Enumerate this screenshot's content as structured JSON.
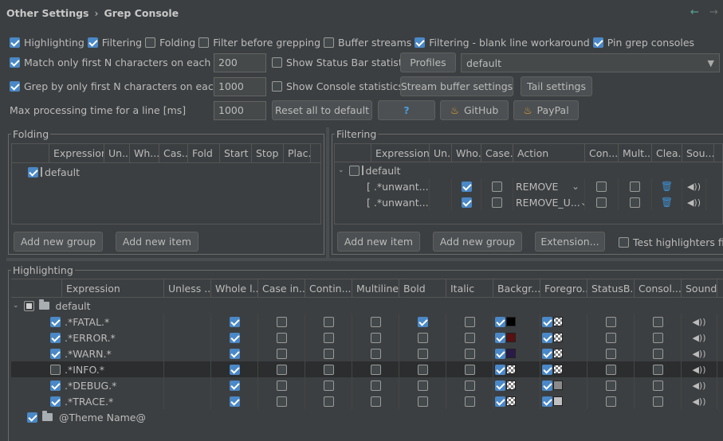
{
  "breadcrumb": {
    "parent": "Other Settings",
    "sep": "›",
    "current": "Grep Console"
  },
  "nav": {
    "back_icon": "←",
    "forward_icon": "→"
  },
  "options_row1": [
    {
      "label": "Highlighting",
      "checked": true
    },
    {
      "label": "Filtering",
      "checked": true
    },
    {
      "label": "Folding",
      "checked": false
    },
    {
      "label": "Filter before grepping",
      "checked": false
    },
    {
      "label": "Buffer streams",
      "checked": false
    },
    {
      "label": "Filtering - blank line workaround",
      "checked": true
    },
    {
      "label": "Pin grep consoles",
      "checked": true
    }
  ],
  "match_first_n": {
    "label": "Match only first N characters on each line",
    "checked": true,
    "value": "200"
  },
  "grep_first_n": {
    "label": "Grep by only first N characters on each line",
    "checked": true,
    "value": "1000"
  },
  "max_time": {
    "label": "Max processing time for a line [ms]",
    "value": "1000"
  },
  "show_statusbar": {
    "label": "Show Status Bar statistics",
    "checked": false
  },
  "show_console": {
    "label": "Show Console statistics",
    "checked": false
  },
  "buttons": {
    "profiles": "Profiles",
    "stream_buffer": "Stream buffer settings",
    "tail": "Tail settings",
    "reset": "Reset all to default",
    "help": "?",
    "github": "GitHub",
    "paypal": "PayPal"
  },
  "profile_select": {
    "value": "default"
  },
  "folding": {
    "title": "Folding",
    "columns": [
      "Expression",
      "Un...",
      "Wh...",
      "Cas...",
      "Fold",
      "Start",
      "Stop",
      "Plac..."
    ],
    "rows": [
      {
        "expression": "default",
        "checked": true
      }
    ],
    "add_group": "Add new group",
    "add_item": "Add new item"
  },
  "filtering": {
    "title": "Filtering",
    "columns": [
      "Expression",
      "Un...",
      "Who...",
      "Case...",
      "Action",
      "Con...",
      "Mult...",
      "Clea...",
      "Sou..."
    ],
    "group": "default",
    "rows": [
      {
        "expression": "[ .*unwant...",
        "whole": true,
        "case": false,
        "action": "REMOVE",
        "con": false,
        "mult": false
      },
      {
        "expression": "[ .*unwant...",
        "whole": true,
        "case": false,
        "action": "REMOVE_U...",
        "con": false,
        "mult": false
      }
    ],
    "add_item": "Add new item",
    "add_group": "Add new group",
    "extension": "Extension...",
    "test_label": "Test highlighters first"
  },
  "highlighting": {
    "title": "Highlighting",
    "columns": [
      "Expression",
      "Unless ...",
      "Whole l...",
      "Case in...",
      "Contin...",
      "Multiline",
      "Bold",
      "Italic",
      "Backgr...",
      "Foregro...",
      "StatusB...",
      "Consol...",
      "Sound"
    ],
    "group": "default",
    "rows": [
      {
        "expression": ".*FATAL.*",
        "enabled": true,
        "whole": true,
        "bold": true,
        "bg": "#000000",
        "fg": "checker",
        "sel": false
      },
      {
        "expression": ".*ERROR.*",
        "enabled": true,
        "whole": true,
        "bold": false,
        "bg": "#5a1010",
        "fg": "checker",
        "sel": false
      },
      {
        "expression": ".*WARN.*",
        "enabled": true,
        "whole": true,
        "bold": false,
        "bg": "#2a1a4a",
        "fg": "checker",
        "sel": false
      },
      {
        "expression": ".*INFO.*",
        "enabled": false,
        "whole": true,
        "bold": false,
        "bg": "checker",
        "fg": "checker",
        "sel": true
      },
      {
        "expression": ".*DEBUG.*",
        "enabled": true,
        "whole": true,
        "bold": false,
        "bg": "checker",
        "fg": "#8a8a8a",
        "sel": false
      },
      {
        "expression": ".*TRACE.*",
        "enabled": true,
        "whole": true,
        "bold": false,
        "bg": "checker",
        "fg": "#c0c0c0",
        "sel": false
      }
    ],
    "theme_group": "@Theme Name@"
  },
  "colors": {
    "bg": "#3c3f41",
    "accent": "#4a88c7",
    "row_selected": "#2b2d2e",
    "table_bg": "#3c3f41"
  }
}
